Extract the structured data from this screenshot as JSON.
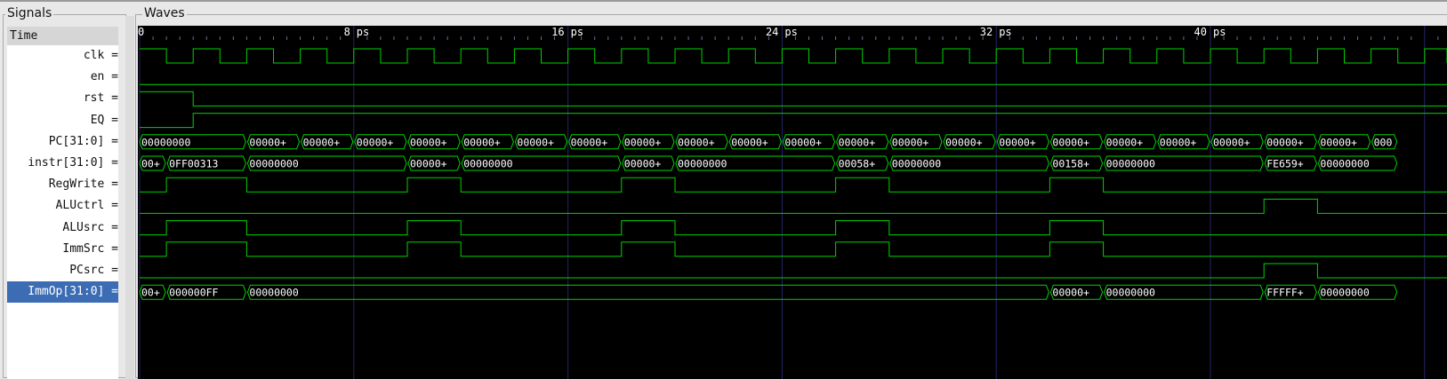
{
  "panels": {
    "signals_title": "Signals",
    "waves_title": "Waves"
  },
  "time_header": "Time",
  "colors": {
    "wave": "#00d200",
    "grid": "#24246a",
    "ruler_text": "#ffffff",
    "selected": "#3c6cb4"
  },
  "ruler": {
    "first_label": "0",
    "labels": [
      {
        "t": 8,
        "text": "8 ps"
      },
      {
        "t": 16,
        "text": "16 ps"
      },
      {
        "t": 24,
        "text": "24 ps"
      },
      {
        "t": 32,
        "text": "32 ps"
      },
      {
        "t": 40,
        "text": "40 ps"
      }
    ]
  },
  "signals": [
    {
      "label": "clk =",
      "kind": "clock",
      "period": 2,
      "high_first": 1
    },
    {
      "label": "en =",
      "kind": "bit",
      "transitions": [
        [
          0,
          0
        ]
      ]
    },
    {
      "label": "rst =",
      "kind": "bit",
      "transitions": [
        [
          0,
          1
        ],
        [
          2,
          0
        ]
      ]
    },
    {
      "label": "EQ =",
      "kind": "bit",
      "transitions": [
        [
          0,
          0
        ],
        [
          2,
          1
        ]
      ]
    },
    {
      "label": "PC[31:0] =",
      "kind": "bus",
      "segments": [
        [
          0,
          4,
          "00000000"
        ],
        [
          4,
          6,
          "00000+"
        ],
        [
          6,
          8,
          "00000+"
        ],
        [
          8,
          10,
          "00000+"
        ],
        [
          10,
          12,
          "00000+"
        ],
        [
          12,
          14,
          "00000+"
        ],
        [
          14,
          16,
          "00000+"
        ],
        [
          16,
          18,
          "00000+"
        ],
        [
          18,
          20,
          "00000+"
        ],
        [
          20,
          22,
          "00000+"
        ],
        [
          22,
          24,
          "00000+"
        ],
        [
          24,
          26,
          "00000+"
        ],
        [
          26,
          28,
          "00000+"
        ],
        [
          28,
          30,
          "00000+"
        ],
        [
          30,
          32,
          "00000+"
        ],
        [
          32,
          34,
          "00000+"
        ],
        [
          34,
          36,
          "00000+"
        ],
        [
          36,
          38,
          "00000+"
        ],
        [
          38,
          40,
          "00000+"
        ],
        [
          40,
          42,
          "00000+"
        ],
        [
          42,
          44,
          "00000+"
        ],
        [
          44,
          46,
          "00000+"
        ],
        [
          46,
          47,
          "000"
        ]
      ]
    },
    {
      "label": "instr[31:0] =",
      "kind": "bus",
      "segments": [
        [
          0,
          1,
          "00+"
        ],
        [
          1,
          4,
          "0FF00313"
        ],
        [
          4,
          10,
          "00000000"
        ],
        [
          10,
          12,
          "00000+"
        ],
        [
          12,
          18,
          "00000000"
        ],
        [
          18,
          20,
          "00000+"
        ],
        [
          20,
          26,
          "00000000"
        ],
        [
          26,
          28,
          "00058+"
        ],
        [
          28,
          34,
          "00000000"
        ],
        [
          34,
          36,
          "00158+"
        ],
        [
          36,
          42,
          "00000000"
        ],
        [
          42,
          44,
          "FE659+"
        ],
        [
          44,
          47,
          "00000000"
        ]
      ]
    },
    {
      "label": "RegWrite =",
      "kind": "bit",
      "transitions": [
        [
          0,
          0
        ],
        [
          1,
          1
        ],
        [
          4,
          0
        ],
        [
          10,
          1
        ],
        [
          12,
          0
        ],
        [
          18,
          1
        ],
        [
          20,
          0
        ],
        [
          26,
          1
        ],
        [
          28,
          0
        ],
        [
          34,
          1
        ],
        [
          36,
          0
        ]
      ]
    },
    {
      "label": "ALUctrl =",
      "kind": "bit",
      "transitions": [
        [
          0,
          0
        ],
        [
          42,
          1
        ],
        [
          44,
          0
        ]
      ]
    },
    {
      "label": "ALUsrc =",
      "kind": "bit",
      "transitions": [
        [
          0,
          0
        ],
        [
          1,
          1
        ],
        [
          4,
          0
        ],
        [
          10,
          1
        ],
        [
          12,
          0
        ],
        [
          18,
          1
        ],
        [
          20,
          0
        ],
        [
          26,
          1
        ],
        [
          28,
          0
        ],
        [
          34,
          1
        ],
        [
          36,
          0
        ]
      ]
    },
    {
      "label": "ImmSrc =",
      "kind": "bit",
      "transitions": [
        [
          0,
          0
        ],
        [
          1,
          1
        ],
        [
          4,
          0
        ],
        [
          10,
          1
        ],
        [
          12,
          0
        ],
        [
          18,
          1
        ],
        [
          20,
          0
        ],
        [
          26,
          1
        ],
        [
          28,
          0
        ],
        [
          34,
          1
        ],
        [
          36,
          0
        ]
      ]
    },
    {
      "label": "PCsrc =",
      "kind": "bit",
      "transitions": [
        [
          0,
          0
        ],
        [
          42,
          1
        ],
        [
          44,
          0
        ]
      ]
    },
    {
      "label": "ImmOp[31:0] =",
      "kind": "bus",
      "selected": true,
      "segments": [
        [
          0,
          1,
          "00+"
        ],
        [
          1,
          4,
          "000000FF"
        ],
        [
          4,
          34,
          "00000000"
        ],
        [
          34,
          36,
          "00000+"
        ],
        [
          36,
          42,
          "00000000"
        ],
        [
          42,
          44,
          "FFFFF+"
        ],
        [
          44,
          47,
          "00000000"
        ]
      ]
    }
  ]
}
